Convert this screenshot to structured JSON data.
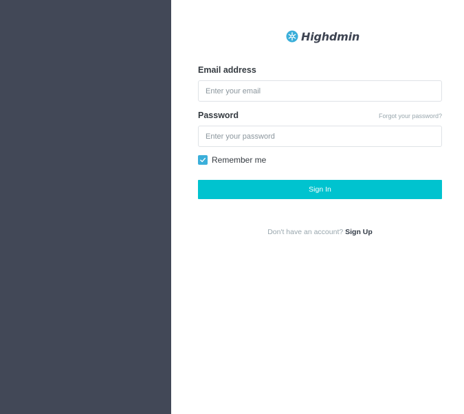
{
  "brand": {
    "name": "Highdmin",
    "icon": "snowflake-icon",
    "accent": "#3bafda"
  },
  "form": {
    "email_label": "Email address",
    "email_placeholder": "Enter your email",
    "email_value": "",
    "password_label": "Password",
    "forgot_link": "Forgot your password?",
    "password_placeholder": "Enter your password",
    "password_value": "",
    "remember_label": "Remember me",
    "remember_checked": true,
    "submit_label": "Sign In"
  },
  "footer": {
    "prompt": "Don't have an account?",
    "signup_link": "Sign Up"
  },
  "colors": {
    "side_panel": "#424857",
    "button": "#00c3cf",
    "checkbox": "#3bafda"
  }
}
